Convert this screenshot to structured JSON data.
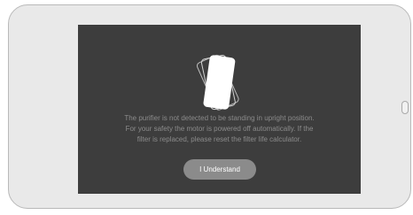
{
  "dialog": {
    "icon": "tilted-device-icon",
    "message_lines": [
      "The purifier is not detected to be standing in upright position.",
      "For your safety the motor is powered off automatically. If the",
      "filter is replaced, please reset the filter life calculator."
    ],
    "button_label": "I Understand"
  },
  "colors": {
    "screen_background": "#3d3d3d",
    "message_text": "#8b8b8b",
    "button_background": "#8b8b8b",
    "button_text": "#ffffff",
    "device_frame": "#e9e9e9"
  }
}
